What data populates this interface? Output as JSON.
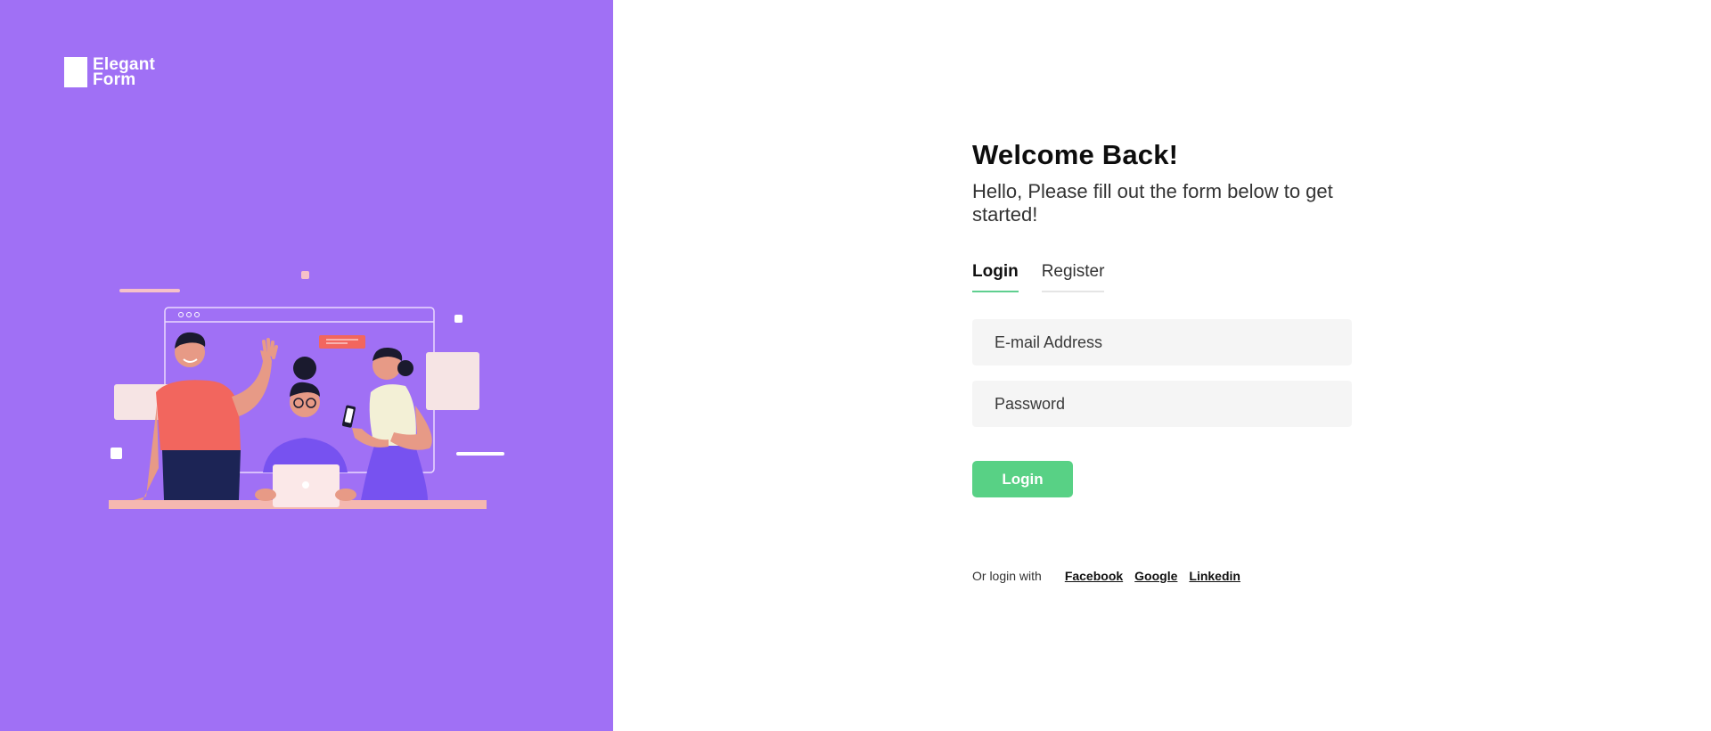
{
  "logo": {
    "line1": "Elegant",
    "line2": "Form"
  },
  "heading": "Welcome Back!",
  "subtitle": "Hello, Please fill out the form below to get started!",
  "tabs": [
    {
      "label": "Login",
      "active": true
    },
    {
      "label": "Register",
      "active": false
    }
  ],
  "form": {
    "email_placeholder": "E-mail Address",
    "email_value": "",
    "password_placeholder": "Password",
    "password_value": "",
    "submit_label": "Login"
  },
  "social": {
    "prompt": "Or login with",
    "links": [
      "Facebook",
      "Google",
      "Linkedin"
    ]
  },
  "colors": {
    "panel": "#a070f5",
    "accent": "#58d185",
    "field_bg": "#f5f5f5"
  }
}
